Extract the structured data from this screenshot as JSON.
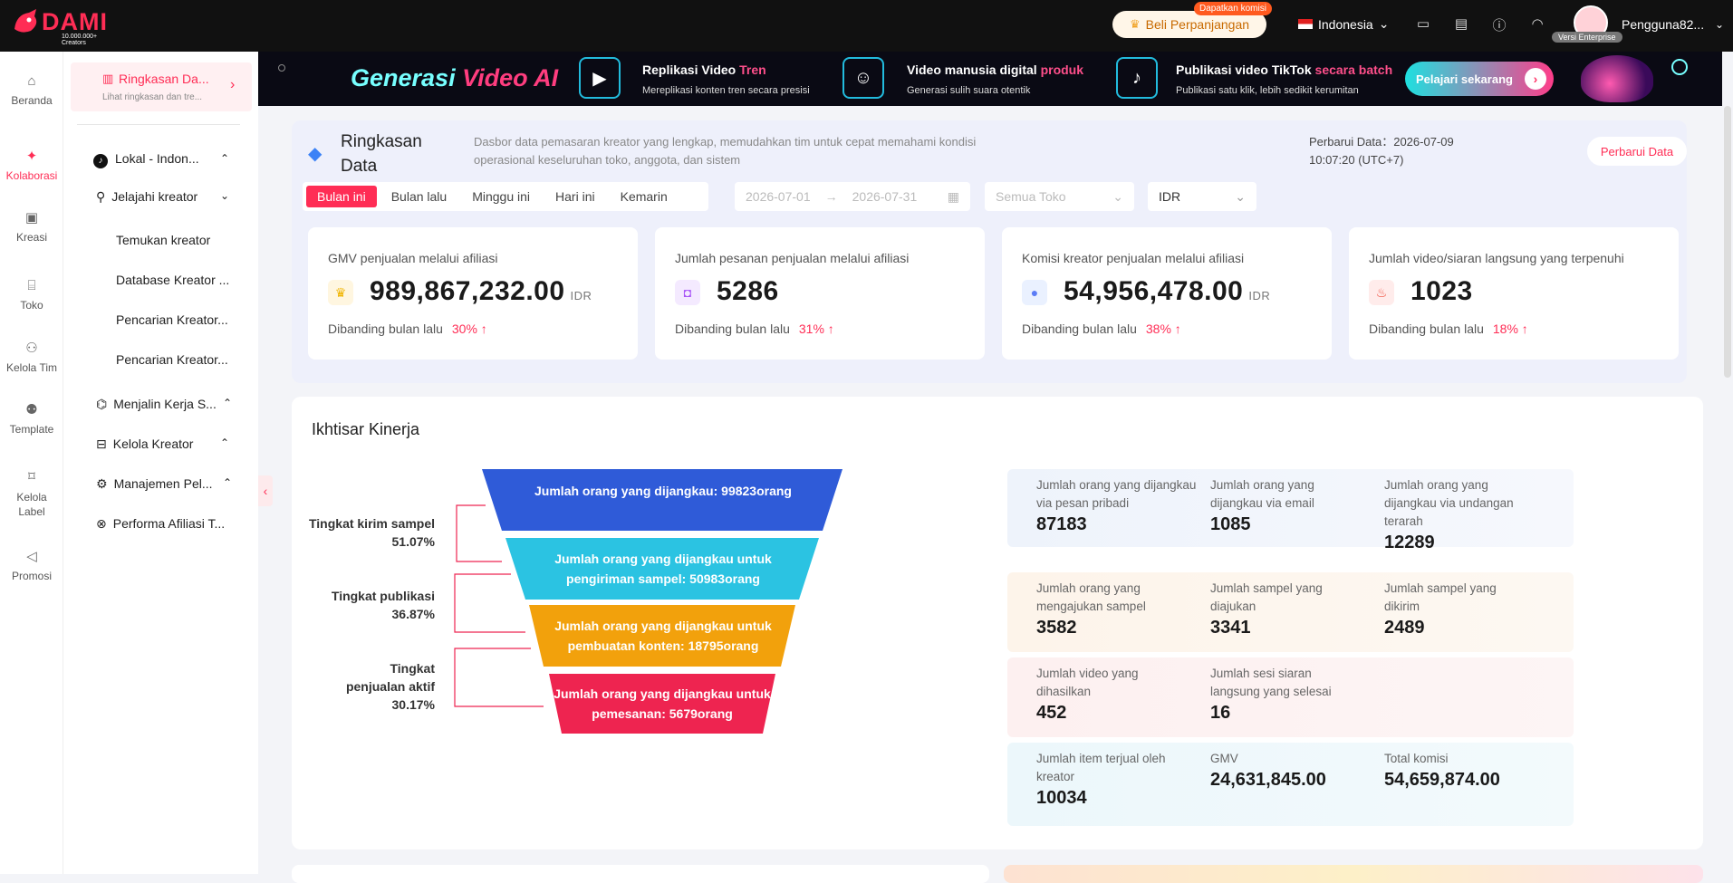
{
  "header": {
    "logo_text": "DAMI",
    "logo_sub": "10.000.000+ Creators",
    "renew_label": "Beli Perpanjangan",
    "komisi_badge": "Dapatkan komisi",
    "language": "Indonesia",
    "enterprise_badge": "Versi Enterprise",
    "username": "Pengguna82..."
  },
  "rail": [
    {
      "label": "Beranda",
      "icon": "home-icon"
    },
    {
      "label": "Kolaborasi",
      "icon": "handshake-icon",
      "active": true
    },
    {
      "label": "Kreasi",
      "icon": "creation-icon"
    },
    {
      "label": "Toko",
      "icon": "store-icon"
    },
    {
      "label": "Kelola Tim",
      "icon": "team-icon"
    },
    {
      "label": "Template",
      "icon": "template-icon"
    },
    {
      "label": "Kelola Label",
      "icon": "label-icon"
    },
    {
      "label": "Promosi",
      "icon": "megaphone-icon"
    }
  ],
  "sidenav": {
    "current_title": "Ringkasan Da...",
    "current_sub": "Lihat ringkasan dan tre...",
    "region": "Lokal - Indon...",
    "items": [
      "Jelajahi kreator",
      "Temukan kreator",
      "Database Kreator ...",
      "Pencarian Kreator...",
      "Pencarian Kreator...",
      "Menjalin Kerja S...",
      "Kelola Kreator",
      "Manajemen Pel...",
      "Performa Afiliasi T..."
    ]
  },
  "banner": {
    "title_a": "Generasi ",
    "title_b": "Video AI",
    "seg1_title": "Replikasi Video ",
    "seg1_hl": "Tren",
    "seg1_sub": "Mereplikasi konten tren secara presisi",
    "seg2_title": "Video manusia digital ",
    "seg2_hl": "produk",
    "seg2_sub": "Generasi sulih suara otentik",
    "seg3_title": "Publikasi video TikTok ",
    "seg3_hl": "secara batch",
    "seg3_sub": "Publikasi satu klik, lebih sedikit kerumitan",
    "cta": "Pelajari sekarang"
  },
  "summary": {
    "title": "Ringkasan Data",
    "description": "Dasbor data pemasaran kreator yang lengkap, memudahkan tim untuk cepat memahami kondisi operasional keseluruhan toko, anggota, dan sistem",
    "updated": "Perbarui Data：2026-07-09 10:07:20 (UTC+7)",
    "update_button": "Perbarui Data",
    "periods": [
      "Bulan ini",
      "Bulan lalu",
      "Minggu ini",
      "Hari ini",
      "Kemarin"
    ],
    "date_from": "2026-07-01",
    "date_to": "2026-07-31",
    "store_placeholder": "Semua Toko",
    "currency": "IDR"
  },
  "kpis": [
    {
      "label": "GMV penjualan melalui afiliasi",
      "value": "989,867,232.00",
      "unit": "IDR",
      "compare": "Dibanding bulan lalu",
      "pct": "30%",
      "icon": "crown-icon",
      "icon_bg": "#fff6e0",
      "icon_color": "#f0b400"
    },
    {
      "label": "Jumlah pesanan penjualan melalui afiliasi",
      "value": "5286",
      "unit": "",
      "compare": "Dibanding bulan lalu",
      "pct": "31%",
      "icon": "bag-icon",
      "icon_bg": "#f4eaff",
      "icon_color": "#a855f7"
    },
    {
      "label": "Komisi kreator penjualan melalui afiliasi",
      "value": "54,956,478.00",
      "unit": "IDR",
      "compare": "Dibanding bulan lalu",
      "pct": "38%",
      "icon": "moneybag-icon",
      "icon_bg": "#eaf1ff",
      "icon_color": "#5b7cf6"
    },
    {
      "label": "Jumlah video/siaran langsung yang terpenuhi",
      "value": "1023",
      "unit": "",
      "compare": "Dibanding bulan lalu",
      "pct": "18%",
      "icon": "fire-icon",
      "icon_bg": "#ffeceb",
      "icon_color": "#f04a3a"
    }
  ],
  "performance": {
    "title": "Ikhtisar Kinerja",
    "funnel": [
      {
        "text": "Jumlah orang yang dijangkau: 99823orang",
        "color": "#2f5bd8"
      },
      {
        "text": "Jumlah orang yang dijangkau untuk pengiriman sampel: 50983orang",
        "color": "#2bc3e2"
      },
      {
        "text": "Jumlah orang yang dijangkau untuk pembuatan konten: 18795orang",
        "color": "#f2a10c"
      },
      {
        "text": "Jumlah orang yang dijangkau untuk pemesanan: 5679orang",
        "color": "#ee2450"
      }
    ],
    "rates": [
      {
        "label": "Tingkat kirim sampel",
        "value": "51.07%"
      },
      {
        "label": "Tingkat publikasi",
        "value": "36.87%"
      },
      {
        "label": "Tingkat penjualan aktif",
        "value": "30.17%"
      }
    ],
    "stats": [
      {
        "bg": "#eef3fb",
        "cells": [
          {
            "label": "Jumlah orang yang dijangkau via pesan pribadi",
            "value": "87183"
          },
          {
            "label": "Jumlah orang yang dijangkau via email",
            "value": "1085"
          },
          {
            "label": "Jumlah orang yang dijangkau via undangan terarah",
            "value": "12289"
          }
        ]
      },
      {
        "bg": "#fdf4ea",
        "cells": [
          {
            "label": "Jumlah orang yang mengajukan sampel",
            "value": "3582"
          },
          {
            "label": "Jumlah sampel yang diajukan",
            "value": "3341"
          },
          {
            "label": "Jumlah sampel yang dikirim",
            "value": "2489"
          }
        ]
      },
      {
        "bg": "#fdf0f0",
        "cells": [
          {
            "label": "Jumlah video yang dihasilkan",
            "value": "452"
          },
          {
            "label": "Jumlah sesi siaran langsung yang selesai",
            "value": "16"
          }
        ]
      },
      {
        "bg": "#ecf7fb",
        "cells": [
          {
            "label": "Jumlah item terjual oleh kreator",
            "value": "10034"
          },
          {
            "label": "GMV",
            "value": "24,631,845.00"
          },
          {
            "label": "Total komisi",
            "value": "54,659,874.00"
          }
        ]
      }
    ]
  }
}
